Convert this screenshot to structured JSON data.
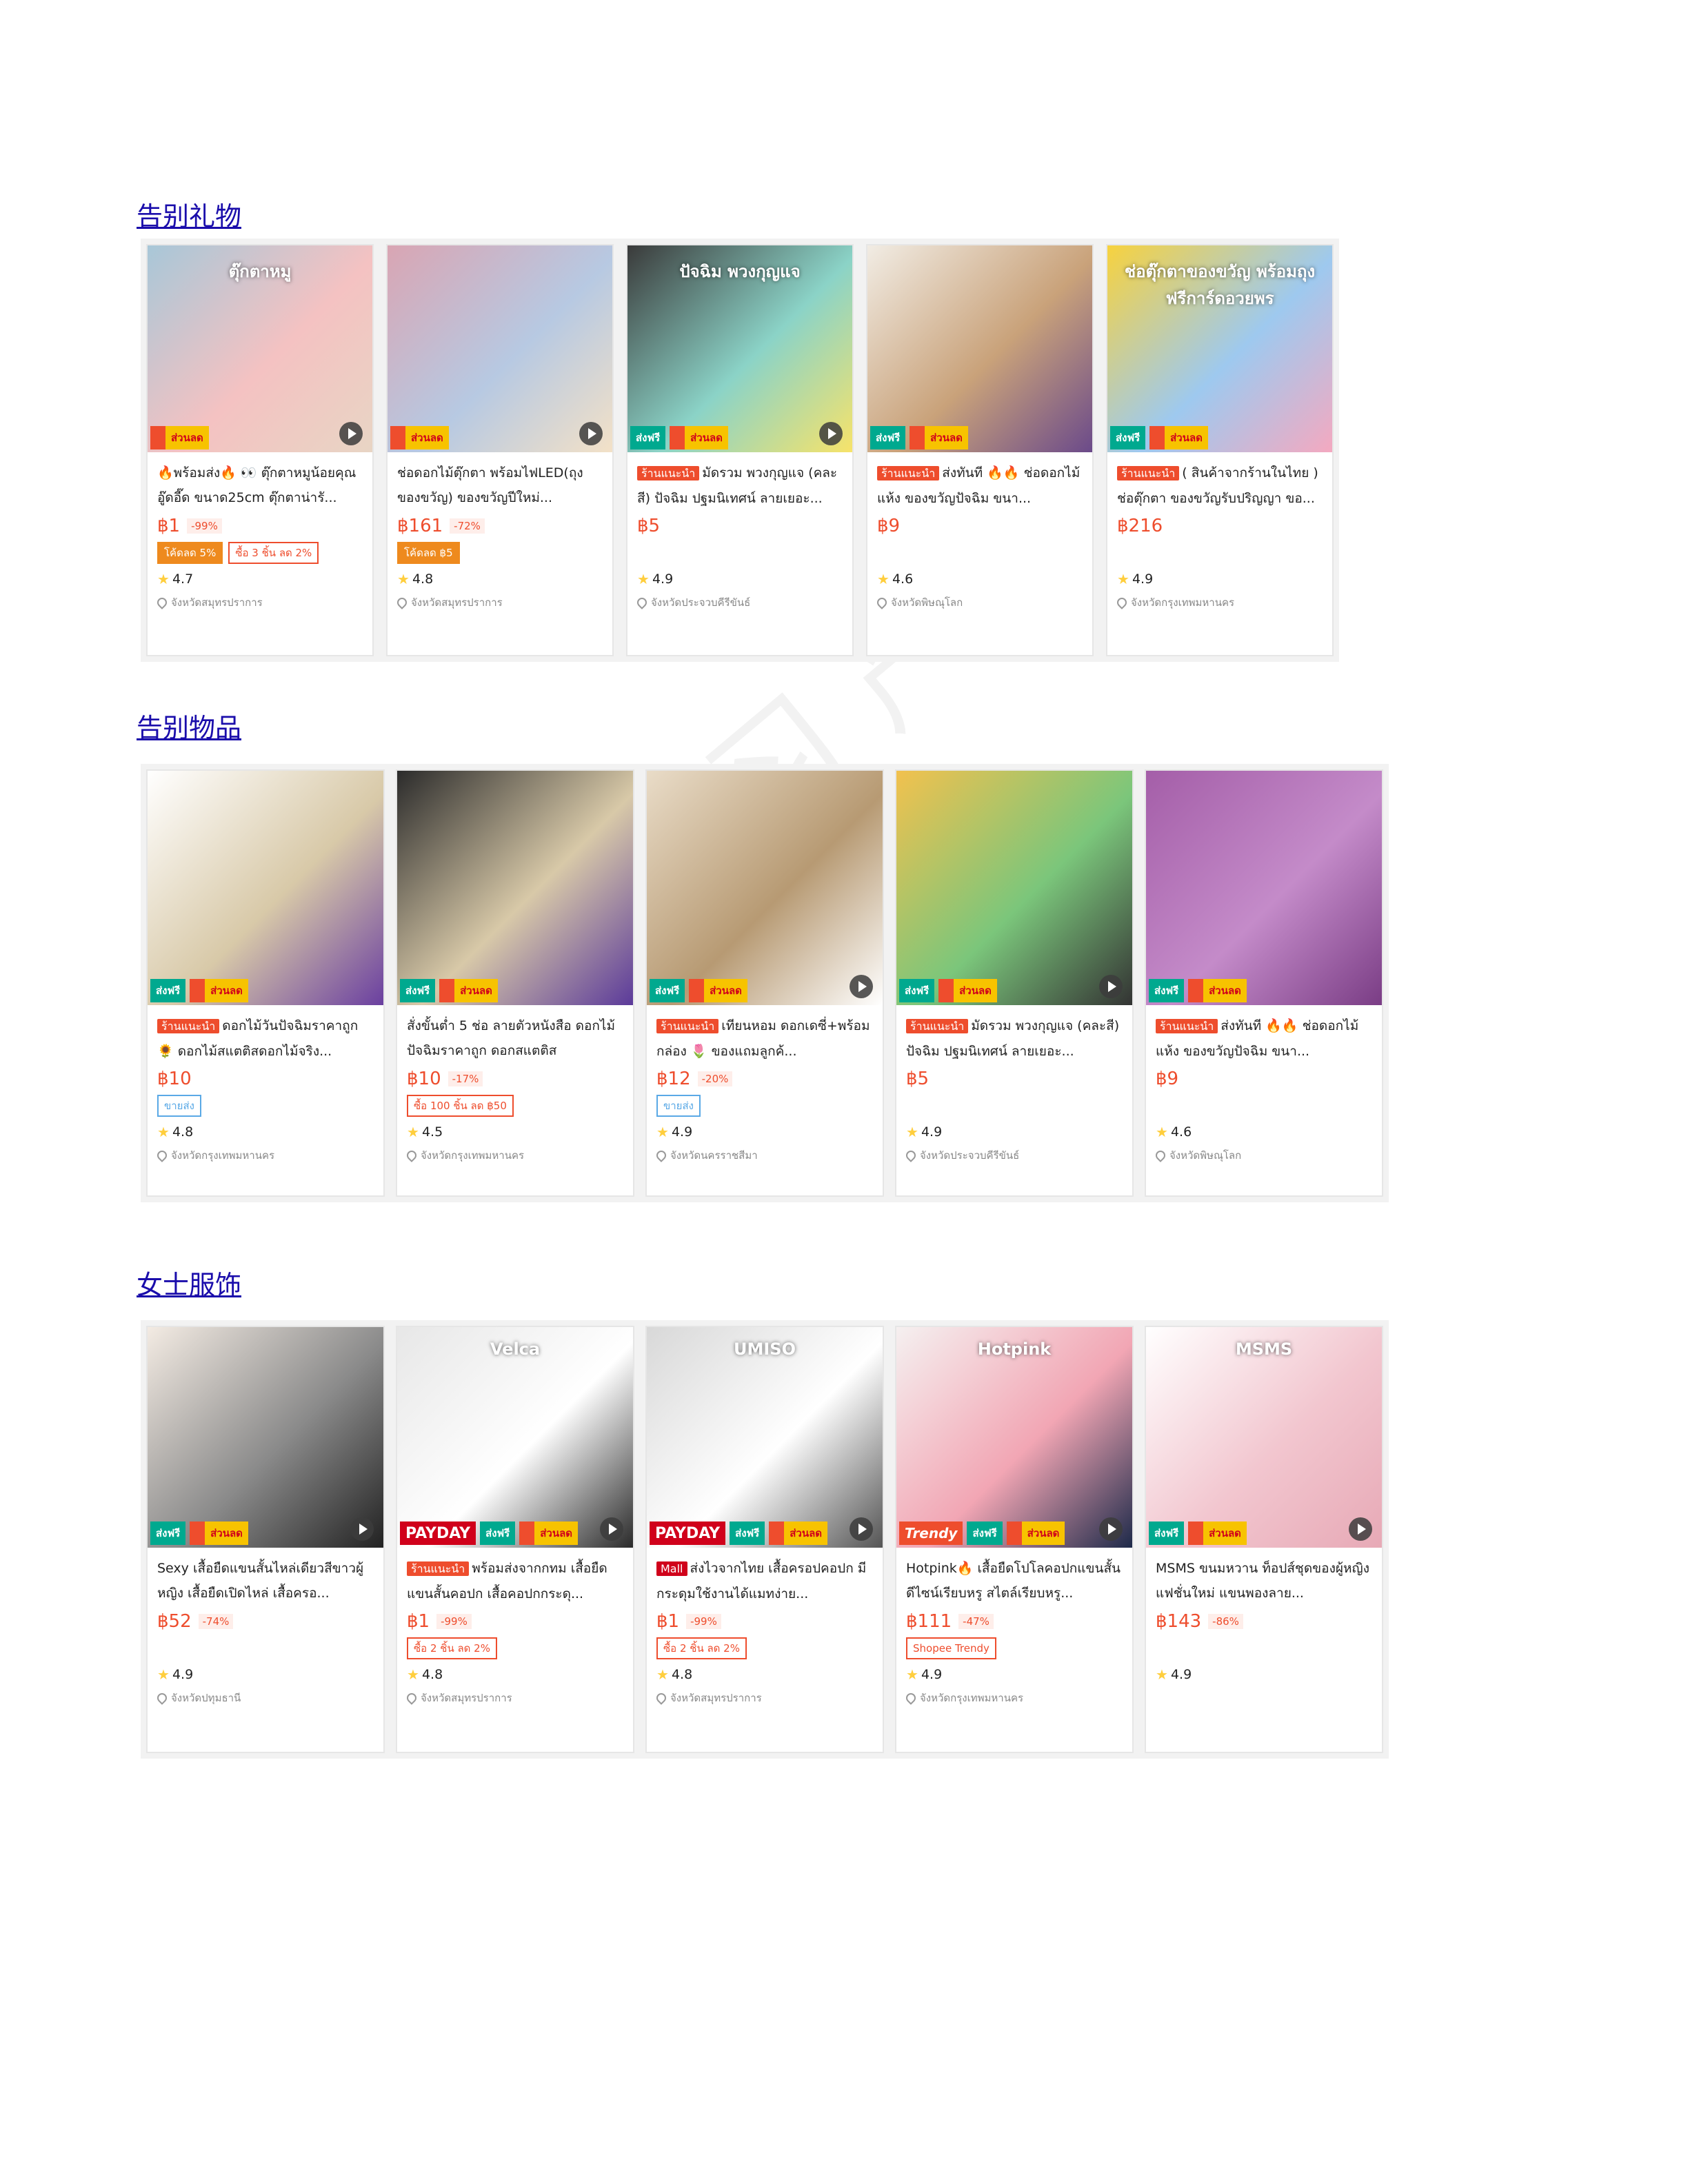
{
  "sections": [
    {
      "title": "告别礼物",
      "cards": [
        {
          "tag": "",
          "title": "🔥พร้อมส่ง🔥 👀 ตุ๊กตาหมูน้อยคุณอู๊ดอี๊ด ขนาด25cm ตุ๊กตาน่ารั...",
          "price": "฿1",
          "pct": "-99%",
          "vouchers": [
            "โค้ดลด 5%",
            "ซื้อ 3 ชิ้น ลด 2%"
          ],
          "rating": "4.7",
          "location": "จังหวัดสมุทรปราการ",
          "badges": [
            "ส่วนลด"
          ],
          "image_text": "ตุ๊กตาหมู",
          "play": true,
          "colors": [
            "#a8c7d8",
            "#f4c2c2",
            "#e8d5c4"
          ]
        },
        {
          "tag": "",
          "title": "ช่อดอกไม้ตุ๊กตา พร้อมไฟLED(ถุงของขวัญ) ของขวัญปีใหม่...",
          "price": "฿161",
          "pct": "-72%",
          "vouchers": [
            "โค้ดลด ฿5"
          ],
          "rating": "4.8",
          "location": "จังหวัดสมุทรปราการ",
          "badges": [
            "ส่วนลด"
          ],
          "image_text": "",
          "play": true,
          "colors": [
            "#d9a5b3",
            "#b7c9e2",
            "#f3e1c7"
          ]
        },
        {
          "tag": "ร้านแนะนำ",
          "title": "มัดรวม พวงกุญแจ (คละสี) ปัจฉิม ปฐมนิเทศน์ ลายเยอะ...",
          "price": "฿5",
          "pct": "",
          "vouchers": [],
          "rating": "4.9",
          "location": "จังหวัดประจวบคีรีขันธ์",
          "badges": [
            "ส่งฟรี",
            "ส่วนลด"
          ],
          "image_text": "ปัจฉิม พวงกุญแจ",
          "play": true,
          "colors": [
            "#3a3a3a",
            "#8bd3c7",
            "#f7e36a"
          ]
        },
        {
          "tag": "ร้านแนะนำ",
          "title": "ส่งทันที 🔥🔥 ช่อดอกไม้แห้ง ของขวัญปัจฉิม ขนา...",
          "price": "฿9",
          "pct": "",
          "vouchers": [],
          "rating": "4.6",
          "location": "จังหวัดพิษณุโลก",
          "badges": [
            "ส่งฟรี",
            "ส่วนลด"
          ],
          "image_text": "",
          "play": false,
          "colors": [
            "#f1ece4",
            "#c9a27a",
            "#6b4a8a"
          ]
        },
        {
          "tag": "ร้านแนะนำ",
          "title": "( สินค้าจากร้านในไทย ) ช่อตุ๊กตา ของขวัญรับปริญญา ขอ...",
          "price": "฿216",
          "pct": "",
          "vouchers": [],
          "rating": "4.9",
          "location": "จังหวัดกรุงเทพมหานคร",
          "badges": [
            "ส่งฟรี",
            "ส่วนลด"
          ],
          "image_text": "ช่อตุ๊กตาของขวัญ พร้อมถุง ฟรีการ์ดอวยพร",
          "play": false,
          "colors": [
            "#f7d23e",
            "#9ec9ef",
            "#f4a9c0"
          ]
        }
      ]
    },
    {
      "title": "告别物品",
      "cards": [
        {
          "tag": "ร้านแนะนำ",
          "title": "ดอกไม้วันปัจฉิมราคาถูก 🌻 ดอกไม้สแตติสดอกไม้จริง...",
          "price": "฿10",
          "pct": "",
          "vouchers": [
            "ขายส่ง"
          ],
          "voucher_style": "blue",
          "rating": "4.8",
          "location": "จังหวัดกรุงเทพมหานคร",
          "badges": [
            "ส่งฟรี",
            "ส่วนลด"
          ],
          "image_text": "",
          "play": false,
          "colors": [
            "#ffffff",
            "#d8c9a8",
            "#6a3fa0"
          ]
        },
        {
          "tag": "",
          "title": "สั่งขั้นต่ำ 5 ช่อ ลายตัวหนังสือ ดอกไม้ปัจฉิมราคาถูก ดอกสแตติส",
          "price": "฿10",
          "pct": "-17%",
          "vouchers": [
            "ซื้อ 100 ชิ้น ลด ฿50"
          ],
          "rating": "4.5",
          "location": "จังหวัดกรุงเทพมหานคร",
          "badges": [
            "ส่งฟรี",
            "ส่วนลด"
          ],
          "image_text": "",
          "play": false,
          "colors": [
            "#2b2b2b",
            "#d8c9a8",
            "#5b3a9a"
          ]
        },
        {
          "tag": "ร้านแนะนำ",
          "title": "เทียนหอม ดอกเดซี่+พร้อมกล่อง 🌷 ของแถมลูกค้...",
          "price": "฿12",
          "pct": "-20%",
          "vouchers": [
            "ขายส่ง"
          ],
          "voucher_style": "blue",
          "rating": "4.9",
          "location": "จังหวัดนครราชสีมา",
          "badges": [
            "ส่งฟรี",
            "ส่วนลด"
          ],
          "image_text": "",
          "play": true,
          "colors": [
            "#e9dcc8",
            "#b79a73",
            "#ffffff"
          ]
        },
        {
          "tag": "ร้านแนะนำ",
          "title": "มัดรวม พวงกุญแจ (คละสี) ปัจฉิม ปฐมนิเทศน์ ลายเยอะ...",
          "price": "฿5",
          "pct": "",
          "vouchers": [],
          "rating": "4.9",
          "location": "จังหวัดประจวบคีรีขันธ์",
          "badges": [
            "ส่งฟรี",
            "ส่วนลด"
          ],
          "image_text": "",
          "play": true,
          "colors": [
            "#f2c14e",
            "#7bc67b",
            "#333333"
          ]
        },
        {
          "tag": "ร้านแนะนำ",
          "title": "ส่งทันที 🔥🔥 ช่อดอกไม้แห้ง ของขวัญปัจฉิม ขนา...",
          "price": "฿9",
          "pct": "",
          "vouchers": [],
          "rating": "4.6",
          "location": "จังหวัดพิษณุโลก",
          "badges": [
            "ส่งฟรี",
            "ส่วนลด"
          ],
          "image_text": "",
          "play": false,
          "colors": [
            "#a45ea8",
            "#c48bc9",
            "#7a3d85"
          ]
        }
      ]
    },
    {
      "title": "女士服饰",
      "cards": [
        {
          "tag": "",
          "title": "Sexy เสื้อยืดแขนสั้นไหล่เดียวสีขาวผู้หญิง เสื้อยืดเปิดไหล่ เสื้อครอ...",
          "price": "฿52",
          "pct": "-74%",
          "vouchers": [],
          "rating": "4.9",
          "location": "จังหวัดปทุมธานี",
          "badges": [
            "ส่งฟรี",
            "ส่วนลด"
          ],
          "image_text": "",
          "play": true,
          "colors": [
            "#f3ebe3",
            "#8a8a8a",
            "#222222"
          ]
        },
        {
          "tag": "ร้านแนะนำ",
          "title": "พร้อมส่งจากกทม เสื้อยืดแขนสั้นคอปก เสื้อคอปกกระดุ...",
          "price": "฿1",
          "pct": "-99%",
          "vouchers": [
            "ซื้อ 2 ชิ้น ลด 2%"
          ],
          "rating": "4.8",
          "location": "จังหวัดสมุทรปราการ",
          "badges": [
            "PAYDAY",
            "ส่งฟรี",
            "ส่วนลด"
          ],
          "image_text": "Velca",
          "play": true,
          "colors": [
            "#e7e7e7",
            "#ffffff",
            "#2a2a2a"
          ]
        },
        {
          "tag": "Mall",
          "title": "ส่งไวจากไทย เสื้อครอปคอปก มีกระดุมใช้งานได้แมทง่าย...",
          "price": "฿1",
          "pct": "-99%",
          "vouchers": [
            "ซื้อ 2 ชิ้น ลด 2%"
          ],
          "rating": "4.8",
          "location": "จังหวัดสมุทรปราการ",
          "badges": [
            "PAYDAY",
            "ส่งฟรี",
            "ส่วนลด"
          ],
          "image_text": "UMISO",
          "play": true,
          "colors": [
            "#d8d8d8",
            "#ffffff",
            "#555555"
          ]
        },
        {
          "tag": "",
          "title": "Hotpink🔥 เสื้อยืดโปโลคอปกแขนสั้น ดีไซน์เรียบหรู สไตล์เรียบหรู...",
          "price": "฿111",
          "pct": "-47%",
          "vouchers": [
            "Shopee Trendy"
          ],
          "rating": "4.9",
          "location": "จังหวัดกรุงเทพมหานคร",
          "badges": [
            "Trendy",
            "ส่งฟรี",
            "ส่วนลด"
          ],
          "image_text": "Hotpink",
          "play": true,
          "colors": [
            "#f5f0f0",
            "#f2a6b4",
            "#1e2a4a"
          ]
        },
        {
          "tag": "",
          "title": "MSMS ขนมหวาน ท็อปส์ชุดของผู้หญิง แฟชั่นใหม่ แขนพองลาย...",
          "price": "฿143",
          "pct": "-86%",
          "vouchers": [],
          "rating": "4.9",
          "location": "",
          "badges": [
            "ส่งฟรี",
            "ส่วนลด"
          ],
          "image_text": "MSMS",
          "play": true,
          "colors": [
            "#ffffff",
            "#f2c6cf",
            "#e7a9b6"
          ]
        }
      ]
    }
  ],
  "watermark": "学习 严禁转载"
}
